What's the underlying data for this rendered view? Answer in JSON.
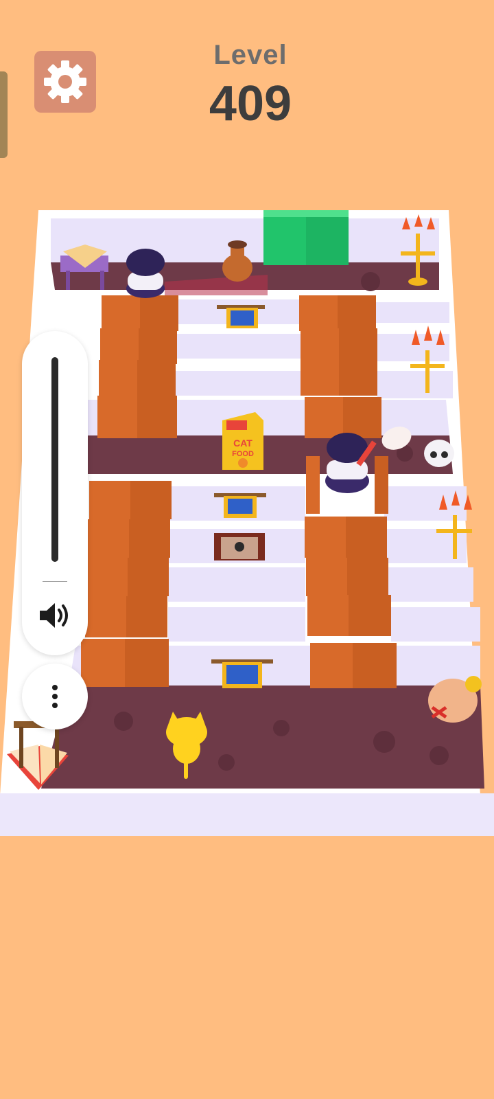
{
  "header": {
    "level_label": "Level",
    "level_number": "409"
  },
  "props": {
    "cat_food_line1": "CAT",
    "cat_food_line2": "FOOD"
  },
  "volume": {
    "level_fraction": 1.0
  },
  "icons": {
    "settings": "gear-icon",
    "volume": "speaker-icon",
    "more": "more-vertical-icon"
  },
  "colors": {
    "background": "#ffbd80",
    "floor": "#6e3a48",
    "wall_top": "#ffffff",
    "wall_side": "#e9e3fa",
    "crate": "#d86a2a",
    "green_crate": "#21c46b",
    "player_cat": "#ffd21f"
  }
}
